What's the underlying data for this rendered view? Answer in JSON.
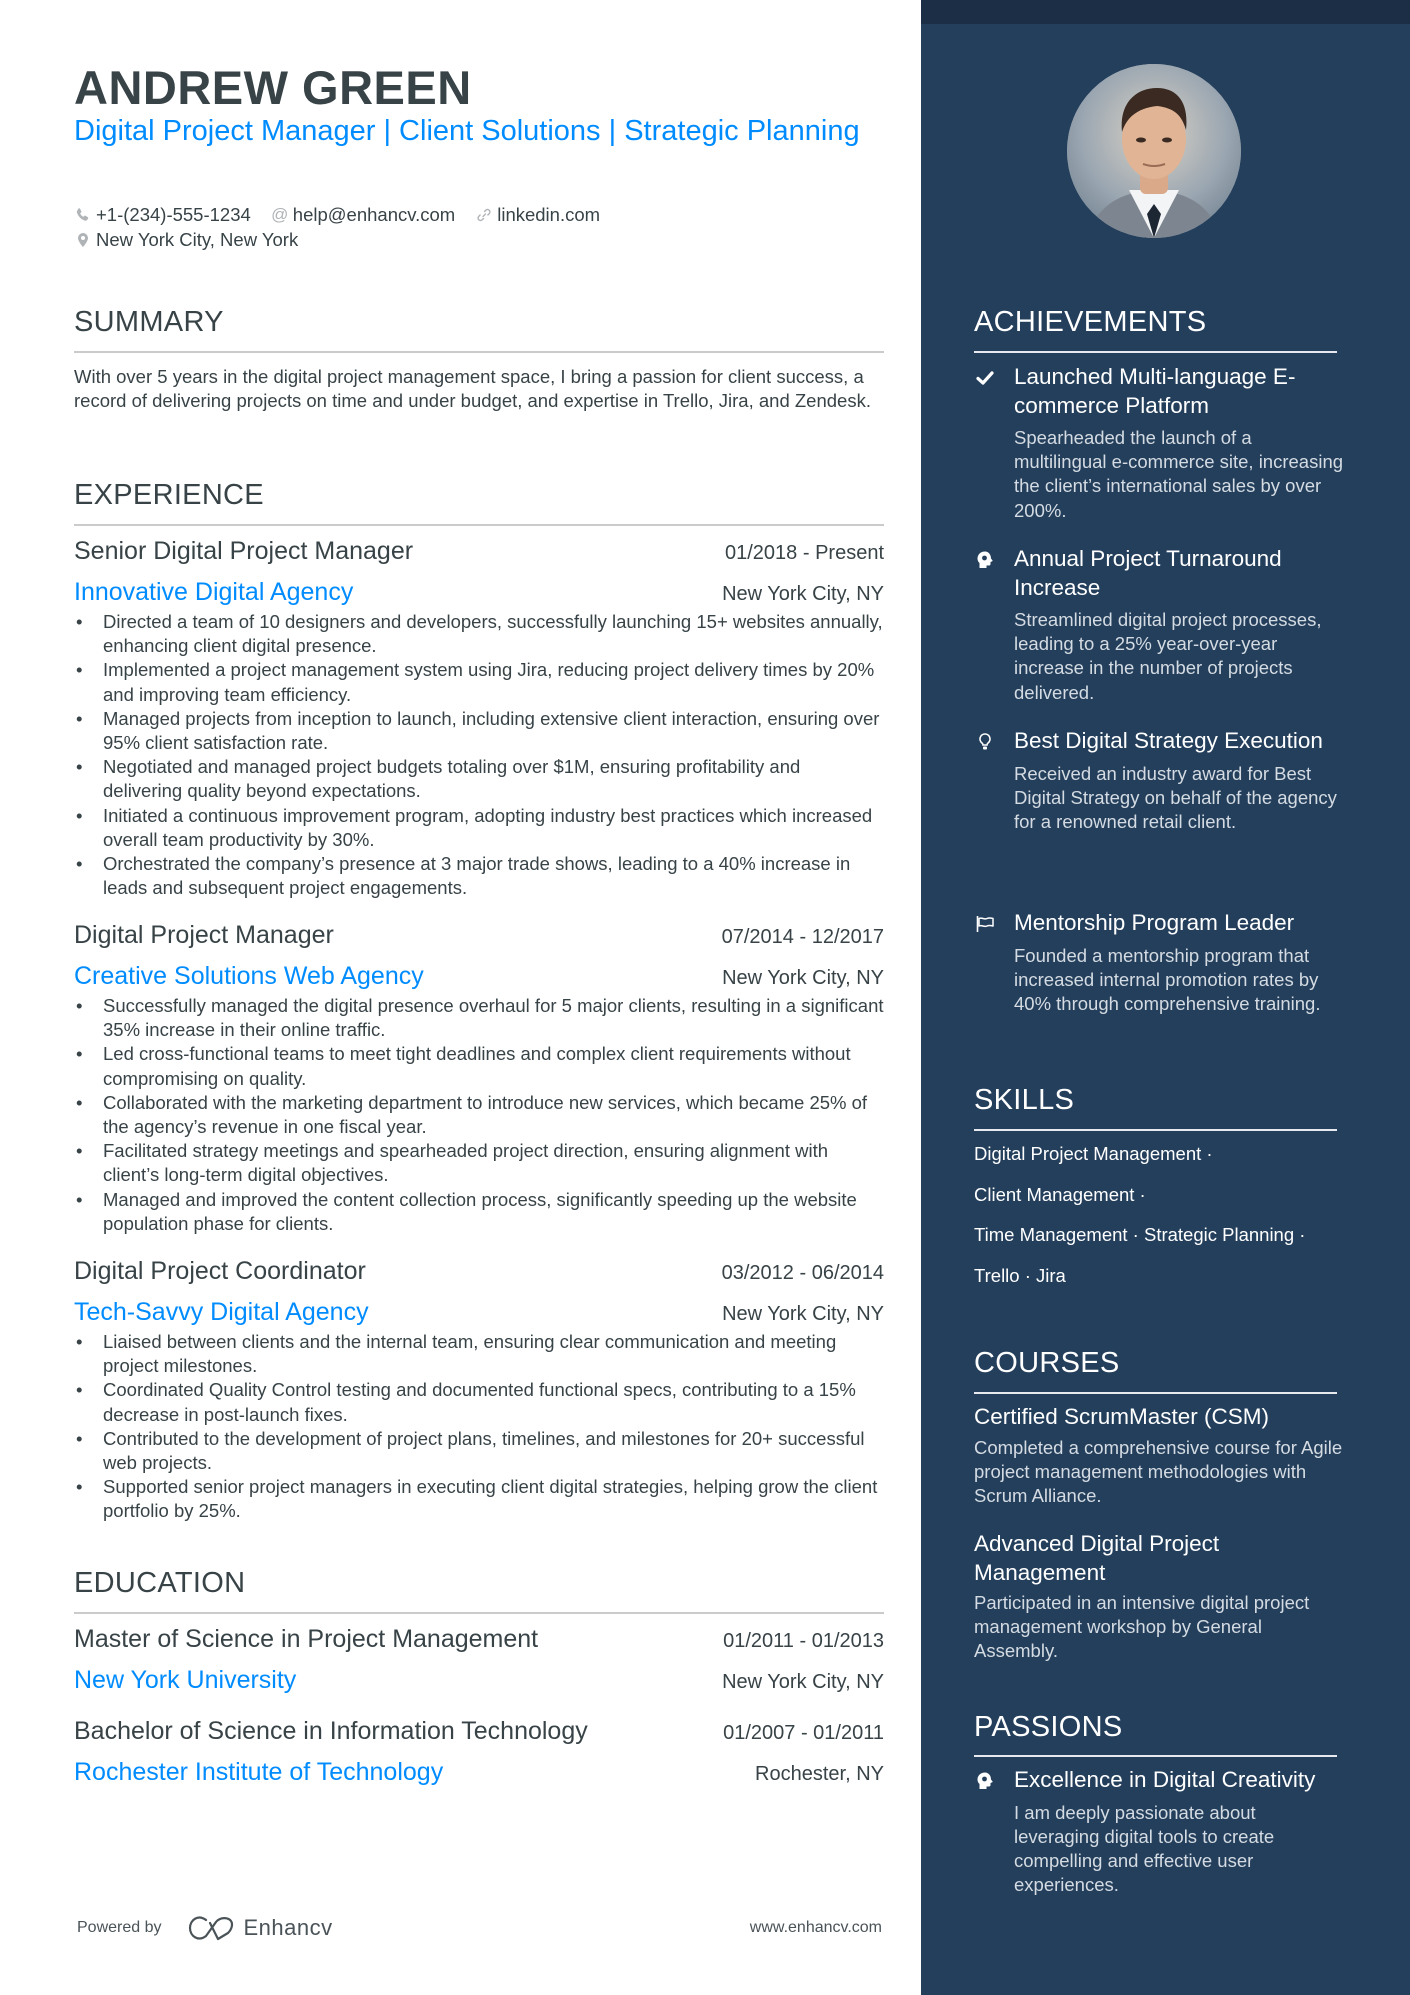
{
  "header": {
    "name": "ANDREW GREEN",
    "headline": "Digital Project Manager | Client Solutions | Strategic Planning",
    "contacts": {
      "phone": "+1-(234)-555-1234",
      "email": "help@enhancv.com",
      "link": "linkedin.com",
      "location": "New York City, New York"
    }
  },
  "summary": {
    "title": "SUMMARY",
    "text": "With over 5 years in the digital project management space, I bring a passion for client success, a record of delivering projects on time and under budget, and expertise in Trello, Jira, and Zendesk."
  },
  "experience": {
    "title": "EXPERIENCE",
    "items": [
      {
        "role": "Senior Digital Project Manager",
        "dates": "01/2018 - Present",
        "company": "Innovative Digital Agency",
        "location": "New York City, NY",
        "bullets": [
          "Directed a team of 10 designers and developers, successfully launching 15+ websites annually, enhancing client digital presence.",
          "Implemented a project management system using Jira, reducing project delivery times by 20% and improving team efficiency.",
          "Managed projects from inception to launch, including extensive client interaction, ensuring over 95% client satisfaction rate.",
          "Negotiated and managed project budgets totaling over $1M, ensuring profitability and delivering quality beyond expectations.",
          "Initiated a continuous improvement program, adopting industry best practices which increased overall team productivity by 30%.",
          "Orchestrated the company’s presence at 3 major trade shows, leading to a 40% increase in leads and subsequent project engagements."
        ]
      },
      {
        "role": "Digital Project Manager",
        "dates": "07/2014 - 12/2017",
        "company": "Creative Solutions Web Agency",
        "location": "New York City, NY",
        "bullets": [
          "Successfully managed the digital presence overhaul for 5 major clients, resulting in a significant 35% increase in their online traffic.",
          "Led cross-functional teams to meet tight deadlines and complex client requirements without compromising on quality.",
          "Collaborated with the marketing department to introduce new services, which became 25% of the agency’s revenue in one fiscal year.",
          "Facilitated strategy meetings and spearheaded project direction, ensuring alignment with client’s long-term digital objectives.",
          "Managed and improved the content collection process, significantly speeding up the website population phase for clients."
        ]
      },
      {
        "role": "Digital Project Coordinator",
        "dates": "03/2012 - 06/2014",
        "company": "Tech-Savvy Digital Agency",
        "location": "New York City, NY",
        "bullets": [
          "Liaised between clients and the internal team, ensuring clear communication and meeting project milestones.",
          "Coordinated Quality Control testing and documented functional specs, contributing to a 15% decrease in post-launch fixes.",
          "Contributed to the development of project plans, timelines, and milestones for 20+ successful web projects.",
          "Supported senior project managers in executing client digital strategies, helping grow the client portfolio by 25%."
        ]
      }
    ]
  },
  "education": {
    "title": "EDUCATION",
    "items": [
      {
        "degree": "Master of Science in Project Management",
        "dates": "01/2011 - 01/2013",
        "school": "New York University",
        "location": "New York City, NY"
      },
      {
        "degree": "Bachelor of Science in Information Technology",
        "dates": "01/2007 - 01/2011",
        "school": "Rochester Institute of Technology",
        "location": "Rochester, NY"
      }
    ]
  },
  "footer": {
    "powered_by": "Powered by",
    "brand": "Enhancv",
    "url": "www.enhancv.com"
  },
  "sidebar": {
    "photo_alt": "Profile photo of Andrew Green",
    "achievements": {
      "title": "ACHIEVEMENTS",
      "items": [
        {
          "icon": "check-icon",
          "title": "Launched Multi-language E-commerce Platform",
          "desc": "Spearheaded the launch of a multilingual e-commerce site, increasing the client’s international sales by over 200%."
        },
        {
          "icon": "head-brain-icon",
          "title": "Annual Project Turnaround Increase",
          "desc": "Streamlined digital project processes, leading to a 25% year-over-year increase in the number of projects delivered."
        },
        {
          "icon": "lightbulb-icon",
          "title": "Best Digital Strategy Execution",
          "desc": "Received an industry award for Best Digital Strategy on behalf of the agency for a renowned retail client."
        },
        {
          "icon": "flag-icon",
          "title": "Mentorship Program Leader",
          "desc": "Founded a mentorship program that increased internal promotion rates by 40% through comprehensive training."
        }
      ]
    },
    "skills": {
      "title": "SKILLS",
      "lines": [
        "Digital Project Management ·",
        "Client Management ·",
        "Time Management · Strategic Planning ·",
        "Trello · Jira"
      ]
    },
    "courses": {
      "title": "COURSES",
      "items": [
        {
          "title": "Certified ScrumMaster (CSM)",
          "desc": "Completed a comprehensive course for Agile project management methodologies with Scrum Alliance."
        },
        {
          "title": "Advanced Digital Project Management",
          "desc": "Participated in an intensive digital project management workshop by General Assembly."
        }
      ]
    },
    "passions": {
      "title": "PASSIONS",
      "items": [
        {
          "icon": "head-brain-icon",
          "title": "Excellence in Digital Creativity",
          "desc": "I am deeply passionate about leveraging digital tools to create compelling and effective user experiences."
        }
      ]
    }
  },
  "colors": {
    "accent": "#008cff",
    "text": "#384347",
    "sidebar_bg": "#243f5c",
    "sidebar_top": "#1b2e45"
  }
}
